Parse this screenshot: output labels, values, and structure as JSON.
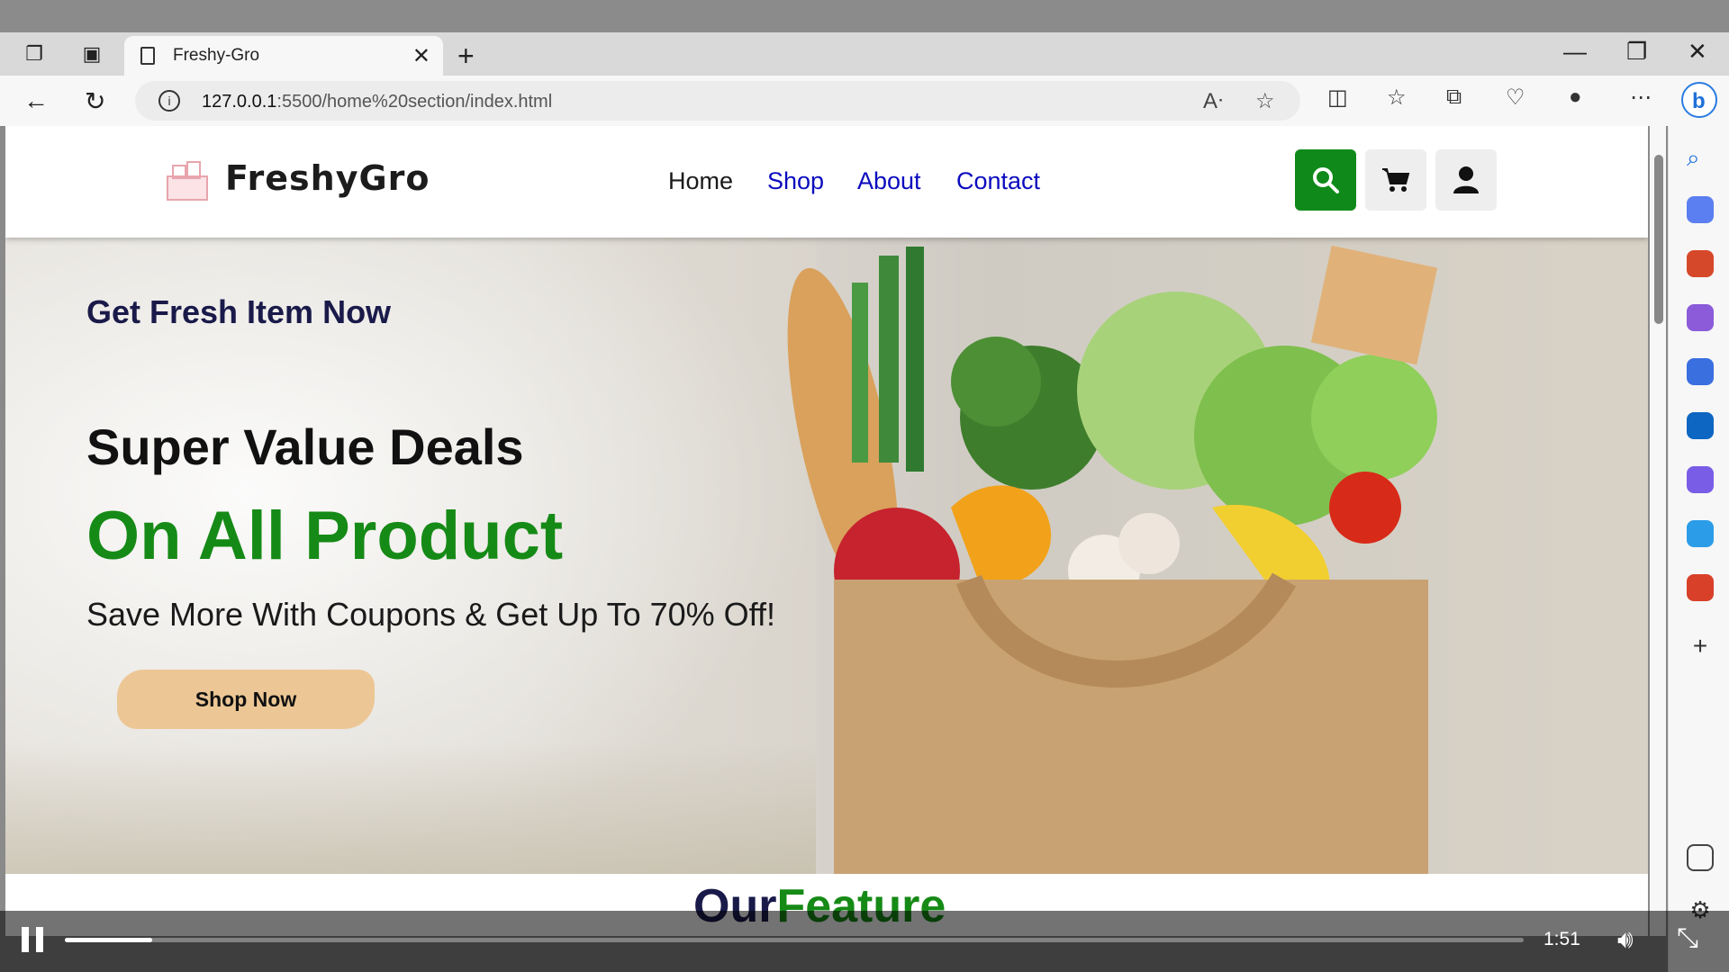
{
  "browser": {
    "tab_title": "Freshy-Gro",
    "url_host": "127.0.0.1",
    "url_path": ":5500/home%20section/index.html"
  },
  "site": {
    "brand": "FreshyGro",
    "nav": [
      "Home",
      "Shop",
      "About",
      "Contact"
    ],
    "colors": {
      "accent_green": "#168a16",
      "nav_blue": "#0b0bbf",
      "search_bg": "#0f8a1a"
    }
  },
  "hero": {
    "kicker": "Get Fresh Item Now",
    "headline": "Super Value Deals",
    "highlight": "On All Product",
    "subtext": "Save More With Coupons & Get Up To 70% Off!",
    "cta": "Shop Now"
  },
  "feature": {
    "title_part1": "Our",
    "title_part2": "Feature"
  },
  "player": {
    "time": "1:51",
    "progress_fraction": 0.06
  },
  "icons": [
    "tab-actions-icon",
    "vertical-tabs-icon",
    "back-icon",
    "refresh-icon",
    "info-icon",
    "read-aloud-icon",
    "favorite-star-icon",
    "split-screen-icon",
    "favorites-icon",
    "collections-icon",
    "browser-essentials-icon",
    "profile-icon",
    "more-icon",
    "copilot-icon",
    "search-icon",
    "cart-icon",
    "user-icon",
    "pause-icon",
    "volume-icon",
    "exit-fullscreen-icon"
  ]
}
